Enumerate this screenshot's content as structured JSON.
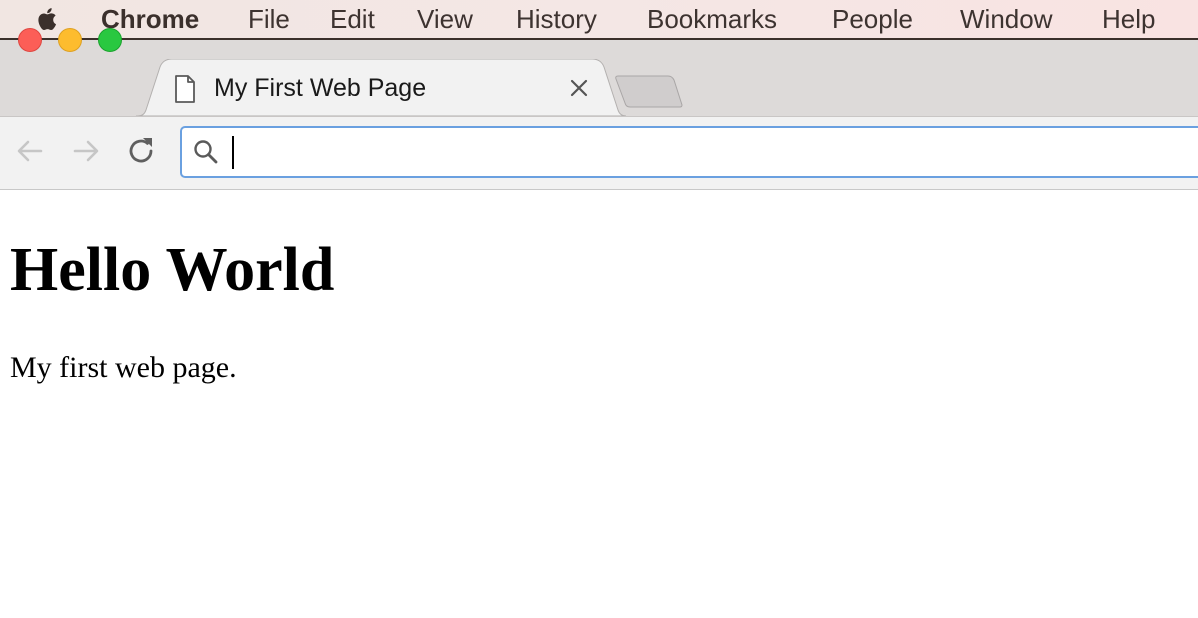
{
  "menubar": {
    "apple_icon": "apple-logo-icon",
    "items": [
      "Chrome",
      "File",
      "Edit",
      "View",
      "History",
      "Bookmarks",
      "People",
      "Window",
      "Help"
    ]
  },
  "window": {
    "controls": [
      "close",
      "minimize",
      "zoom"
    ]
  },
  "tabs": [
    {
      "title": "My First Web Page",
      "icon": "document-page-icon",
      "active": true,
      "close_icon": "close-icon"
    }
  ],
  "new_tab_icon": "new-tab-icon",
  "toolbar": {
    "back_icon": "back-arrow-icon",
    "forward_icon": "forward-arrow-icon",
    "reload_icon": "reload-icon",
    "omnibox": {
      "icon": "search-icon",
      "value": "",
      "focused": true
    }
  },
  "page": {
    "heading": "Hello World",
    "paragraph": "My first web page."
  },
  "colors": {
    "omnibox_focus_border": "#6aa0e0",
    "traffic_close": "#fc5e57",
    "traffic_minimize": "#fdbc2e",
    "traffic_zoom": "#29c840"
  }
}
